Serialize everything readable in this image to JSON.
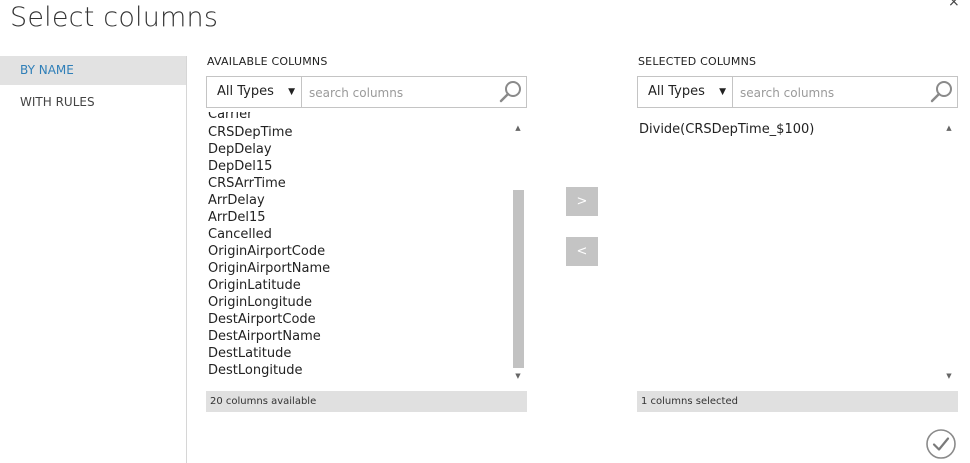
{
  "dialog": {
    "title": "Select columns",
    "close_glyph": "×"
  },
  "nav": {
    "items": [
      {
        "label": "BY NAME",
        "active": true
      },
      {
        "label": "WITH RULES",
        "active": false
      }
    ]
  },
  "available": {
    "header": "AVAILABLE COLUMNS",
    "type_filter": "All Types",
    "search_placeholder": "search columns",
    "partial_item": "Carrier",
    "items": [
      "CRSDepTime",
      "DepDelay",
      "DepDel15",
      "CRSArrTime",
      "ArrDelay",
      "ArrDel15",
      "Cancelled",
      "OriginAirportCode",
      "OriginAirportName",
      "OriginLatitude",
      "OriginLongitude",
      "DestAirportCode",
      "DestAirportName",
      "DestLatitude",
      "DestLongitude"
    ],
    "footer": "20 columns available"
  },
  "selected": {
    "header": "SELECTED COLUMNS",
    "type_filter": "All Types",
    "search_placeholder": "search columns",
    "items": [
      "Divide(CRSDepTime_$100)"
    ],
    "footer": "1 columns selected"
  },
  "actions": {
    "add_label": ">",
    "remove_label": "<"
  },
  "icons": {
    "search": "search-icon",
    "dropdown": "caret-down-icon",
    "scroll_up": "scroll-up-arrow-icon",
    "scroll_down": "scroll-down-arrow-icon",
    "confirm": "checkmark-icon"
  }
}
